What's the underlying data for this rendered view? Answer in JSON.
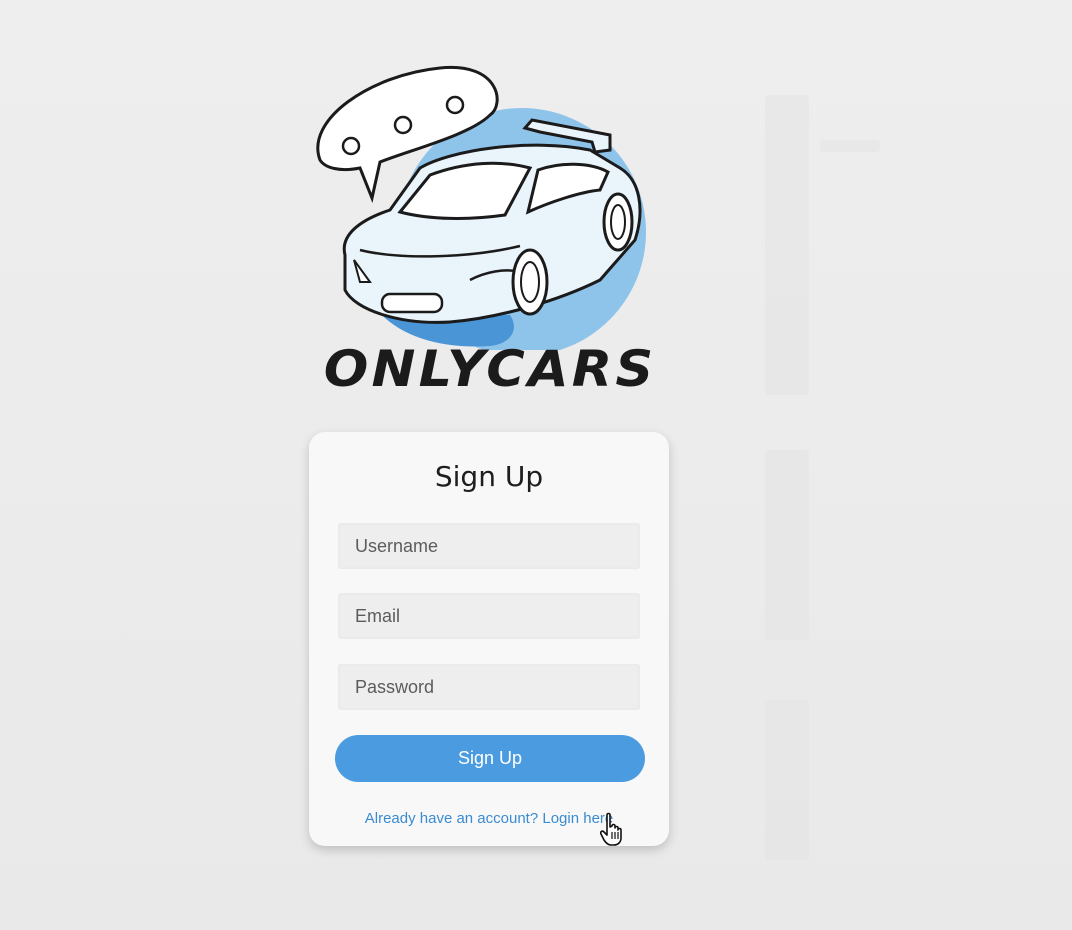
{
  "brand": {
    "name": "ONLYCARS",
    "speech_bubble": "o o o"
  },
  "signup": {
    "title": "Sign Up",
    "username_placeholder": "Username",
    "email_placeholder": "Email",
    "password_placeholder": "Password",
    "submit_label": "Sign Up",
    "login_link_text": "Already have an account? Login here"
  },
  "colors": {
    "accent": "#4a9be0",
    "link": "#3a8bd2",
    "logo_circle": "#8dc3ea",
    "logo_circle_dark": "#4a95d6",
    "background": "#ebebeb",
    "card": "#f8f8f8"
  },
  "icons": {
    "logo": "car-with-speech-bubble-icon",
    "cursor": "hand-pointer-icon"
  }
}
